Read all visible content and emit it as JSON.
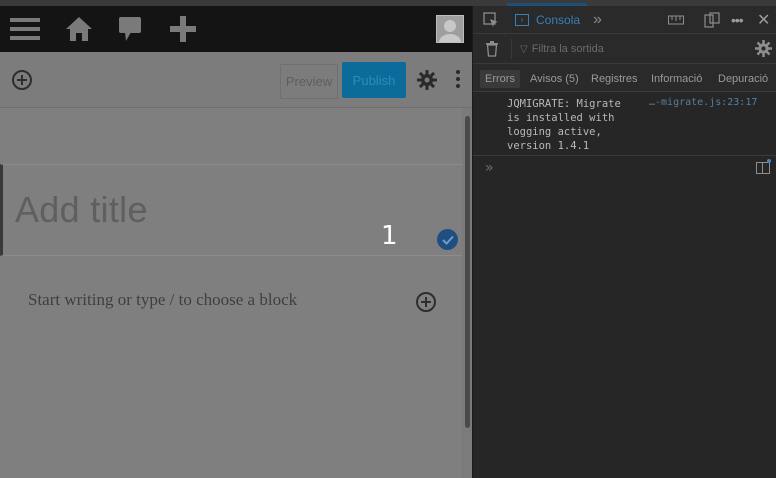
{
  "wordpress": {
    "admin_bar": {
      "icons": [
        "menu-icon",
        "home-icon",
        "comments-icon",
        "new-content-icon",
        "avatar"
      ]
    },
    "toolbar": {
      "preview_label": "Preview",
      "publish_label": "Publish"
    },
    "editor": {
      "title_placeholder": "Add title",
      "block_number": "1",
      "paragraph_placeholder": "Start writing or type / to choose a block"
    }
  },
  "devtools": {
    "tabs": [
      {
        "label": "Consola",
        "active": true
      }
    ],
    "filter_placeholder": "Filtra la sortida",
    "levels": [
      {
        "label": "Errors",
        "selected": true
      },
      {
        "label": "Avisos (5)",
        "selected": false
      },
      {
        "label": "Registres",
        "selected": false
      },
      {
        "label": "Informació",
        "selected": false
      },
      {
        "label": "Depuració",
        "selected": false
      }
    ],
    "log": {
      "message": "JQMIGRATE: Migrate\nis installed with\nlogging active,\nversion 1.4.1",
      "source": "…-migrate.js:23:17"
    },
    "prompt": "»"
  },
  "colors": {
    "accent": "#3b7fb8",
    "publish": "#0b6c9c",
    "check": "#1e4f80"
  }
}
